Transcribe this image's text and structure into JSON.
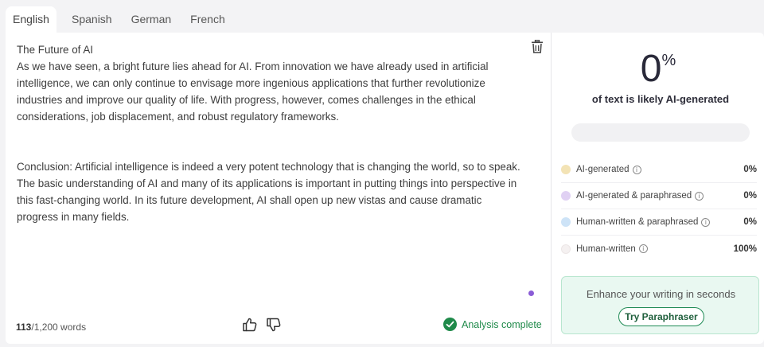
{
  "tabs": [
    "English",
    "Spanish",
    "German",
    "French"
  ],
  "active_tab": "English",
  "editor": {
    "title": "The Future of AI",
    "paragraph1": "As we have seen, a bright future lies ahead for AI. From innovation we have already used in artificial intelligence, we can only continue to envisage more ingenious applications that further revolutionize industries and improve our quality of life. With progress, however, comes challenges in the ethical considerations, job displacement, and robust regulatory frameworks.",
    "paragraph2": "Conclusion: Artificial intelligence is indeed a very potent technology that is changing the world, so to speak. The basic understanding of AI and many of its applications is important in putting things into perspective in this fast-changing world. In its future development, AI shall open up new vistas and cause dramatic progress in many fields.",
    "word_count": "113",
    "word_limit": "/1,200 words",
    "status": "Analysis complete"
  },
  "result": {
    "percent": "0",
    "percent_symbol": "%",
    "caption": "of text is likely AI-generated",
    "legend": [
      {
        "label": "AI-generated",
        "value": "0%",
        "color": "#f3e3b5"
      },
      {
        "label": "AI-generated & paraphrased",
        "value": "0%",
        "color": "#e0d1f3"
      },
      {
        "label": "Human-written & paraphrased",
        "value": "0%",
        "color": "#cde3f7"
      },
      {
        "label": "Human-written",
        "value": "100%",
        "color": "#f5f1f1"
      }
    ]
  },
  "promo": {
    "title": "Enhance your writing in seconds",
    "button": "Try Paraphraser"
  },
  "icons": {
    "trash": "trash-icon",
    "thumbs_up": "thumbs-up-icon",
    "thumbs_down": "thumbs-down-icon",
    "check": "check-circle-icon",
    "info": "info-icon"
  }
}
